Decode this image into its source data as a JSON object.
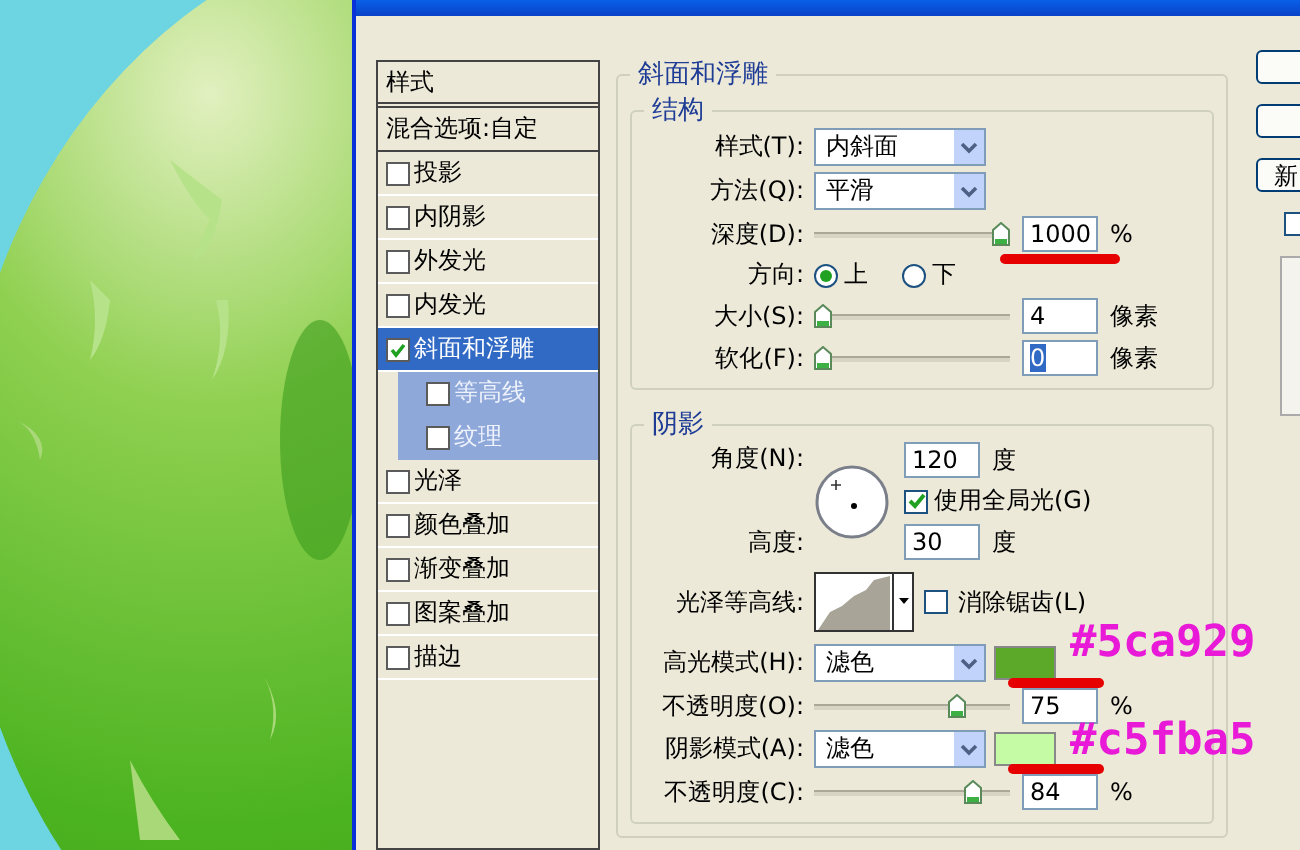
{
  "styles_panel": {
    "header": "样式",
    "blend_options": "混合选项:自定",
    "items": [
      {
        "label": "投影",
        "checked": false,
        "selected": false
      },
      {
        "label": "内阴影",
        "checked": false,
        "selected": false
      },
      {
        "label": "外发光",
        "checked": false,
        "selected": false
      },
      {
        "label": "内发光",
        "checked": false,
        "selected": false
      },
      {
        "label": "斜面和浮雕",
        "checked": true,
        "selected": true,
        "children": [
          {
            "label": "等高线",
            "checked": false,
            "selected": false
          },
          {
            "label": "纹理",
            "checked": false,
            "selected": false
          }
        ]
      },
      {
        "label": "光泽",
        "checked": false,
        "selected": false
      },
      {
        "label": "颜色叠加",
        "checked": false,
        "selected": false
      },
      {
        "label": "渐变叠加",
        "checked": false,
        "selected": false
      },
      {
        "label": "图案叠加",
        "checked": false,
        "selected": false
      },
      {
        "label": "描边",
        "checked": false,
        "selected": false
      }
    ]
  },
  "bevel": {
    "title": "斜面和浮雕",
    "structure": {
      "title": "结构",
      "style": {
        "label": "样式(T):",
        "value": "内斜面"
      },
      "technique": {
        "label": "方法(Q):",
        "value": "平滑"
      },
      "depth": {
        "label": "深度(D):",
        "level": 1.0,
        "value": "1000",
        "unit": "%",
        "marked": true
      },
      "direction": {
        "label": "方向:",
        "options": [
          {
            "label": "上",
            "selected": true
          },
          {
            "label": "下",
            "selected": false
          }
        ]
      },
      "size": {
        "label": "大小(S):",
        "level": 0.0,
        "value": "4",
        "unit": "像素"
      },
      "soften": {
        "label": "软化(F):",
        "level": 0.0,
        "value": "0",
        "unit": "像素",
        "value_selected": true
      }
    },
    "shading": {
      "title": "阴影",
      "angle": {
        "label": "角度(N):",
        "value": "120",
        "unit": "度"
      },
      "global_light": {
        "label": "使用全局光(G)",
        "checked": true
      },
      "altitude": {
        "label": "高度:",
        "value": "30",
        "unit": "度"
      },
      "gloss_contour": {
        "label": "光泽等高线:"
      },
      "anti_alias": {
        "label": "消除锯齿(L)",
        "checked": false
      },
      "highlight_mode": {
        "label": "高光模式(H):",
        "value": "滤色",
        "color": "#5ca929",
        "marked": true,
        "annotation": "#5ca929"
      },
      "highlight_opacity": {
        "label": "不透明度(O):",
        "level": 0.75,
        "value": "75",
        "unit": "%"
      },
      "shadow_mode": {
        "label": "阴影模式(A):",
        "value": "滤色",
        "color": "#c5fba5",
        "marked": true,
        "annotation": "#c5fba5"
      },
      "shadow_opacity": {
        "label": "不透明度(C):",
        "level": 0.84,
        "value": "84",
        "unit": "%"
      }
    }
  },
  "side_buttons": [
    "新"
  ],
  "preview_checkbox": {
    "checked": false
  }
}
